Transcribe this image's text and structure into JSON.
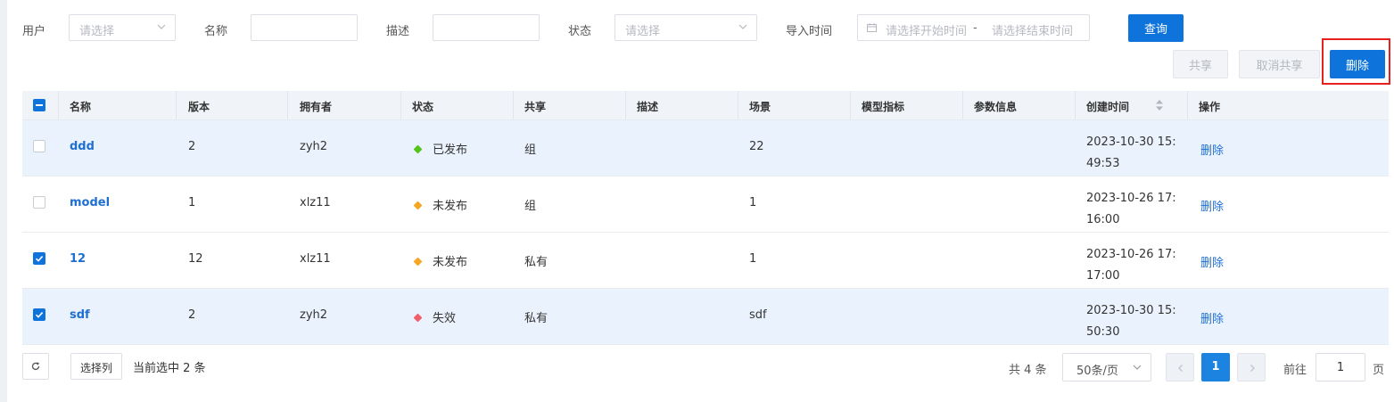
{
  "filters": {
    "user": {
      "label": "用户",
      "placeholder": "请选择"
    },
    "name": {
      "label": "名称",
      "value": ""
    },
    "desc": {
      "label": "描述",
      "value": ""
    },
    "status": {
      "label": "状态",
      "placeholder": "请选择"
    },
    "import_time": {
      "label": "导入时间",
      "start_placeholder": "请选择开始时间",
      "separator": "-",
      "end_placeholder": "请选择结束时间"
    },
    "query_label": "查询"
  },
  "actions": {
    "share": "共享",
    "unshare": "取消共享",
    "delete": "删除"
  },
  "table": {
    "columns": [
      "名称",
      "版本",
      "拥有者",
      "状态",
      "共享",
      "描述",
      "场景",
      "模型指标",
      "参数信息",
      "创建时间",
      "操作"
    ],
    "rows": [
      {
        "name": "ddd",
        "version": "2",
        "owner": "zyh2",
        "status": "已发布",
        "share": "组",
        "desc": "",
        "scene": "22",
        "metric": "",
        "params": "",
        "created": "2023-10-30 15:49:53",
        "op": "删除",
        "checked": false
      },
      {
        "name": "model",
        "version": "1",
        "owner": "xlz11",
        "status": "未发布",
        "share": "组",
        "desc": "",
        "scene": "1",
        "metric": "",
        "params": "",
        "created": "2023-10-26 17:16:00",
        "op": "删除",
        "checked": false
      },
      {
        "name": "12",
        "version": "12",
        "owner": "xlz11",
        "status": "未发布",
        "share": "私有",
        "desc": "",
        "scene": "1",
        "metric": "",
        "params": "",
        "created": "2023-10-26 17:17:00",
        "op": "删除",
        "checked": true
      },
      {
        "name": "sdf",
        "version": "2",
        "owner": "zyh2",
        "status": "失效",
        "share": "私有",
        "desc": "",
        "scene": "sdf",
        "metric": "",
        "params": "",
        "created": "2023-10-30 15:50:30",
        "op": "删除",
        "checked": true
      }
    ]
  },
  "status_colors": {
    "已发布": "#52c41a",
    "未发布": "#f5a623",
    "失效": "#f0606b"
  },
  "footer": {
    "select_columns": "选择列",
    "selected_text": "当前选中 2 条",
    "total_text": "共 4 条",
    "page_size": "50条/页",
    "current_page": "1",
    "goto_label": "前往",
    "goto_value": "1",
    "page_unit": "页"
  }
}
